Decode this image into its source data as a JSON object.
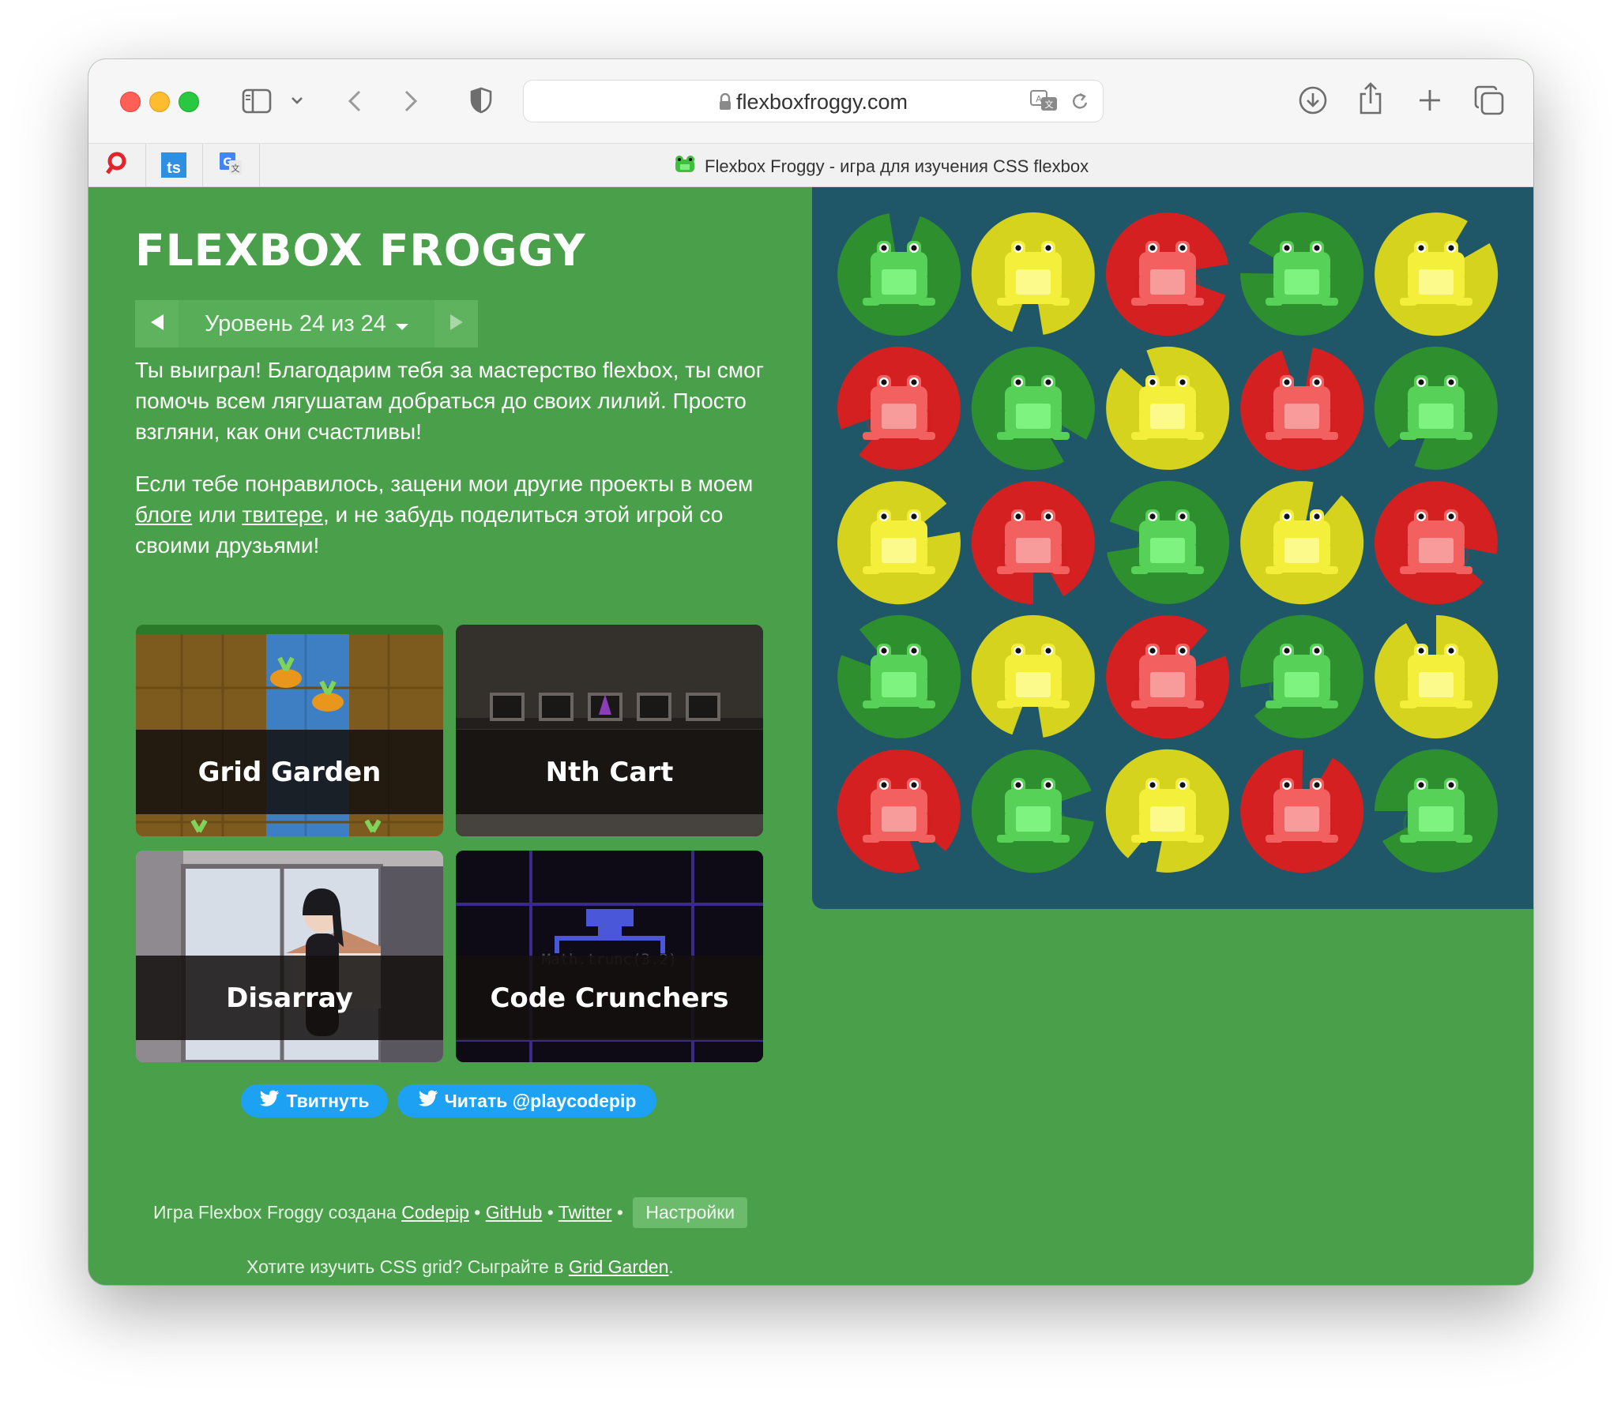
{
  "browser": {
    "url": "flexboxfroggy.com",
    "tab_title": "Flexbox Froggy - игра для изучения CSS flexbox",
    "pinned_tabs": [
      "ts"
    ]
  },
  "game": {
    "title": "FLEXBOX FROGGY",
    "level_label": "Уровень 24 из 24",
    "para1": "Ты выиграл! Благодарим тебя за мастерство flexbox, ты смог помочь всем лягушатам добраться до своих лилий. Просто взгляни, как они счастливы!",
    "para2_a": "Если тебе понравилось, зацени мои другие проекты в моем",
    "para2_link1": "блоге",
    "para2_b": "или",
    "para2_link2": "твитере",
    "para2_c": ", и не забудь поделиться этой игрой со своими друзьями!",
    "cards": [
      {
        "label": "Grid Garden"
      },
      {
        "label": "Nth Cart"
      },
      {
        "label": "Disarray"
      },
      {
        "label": "Code Crunchers",
        "code_hint": "Math.trunc(3.2)"
      }
    ],
    "tweet_button": "Твитнуть",
    "follow_button": "Читать @playcodepip",
    "footer1_text": "Игра Flexbox Froggy создана",
    "footer1_link1": "Codepip",
    "footer1_link2": "GitHub",
    "footer1_link3": "Twitter",
    "footer_separator": "•",
    "settings_button": "Настройки",
    "footer2_text": "Хотите изучить CSS grid? Сыграйте в",
    "footer2_link": "Grid Garden",
    "footer2_end": "."
  },
  "pond": {
    "colors": {
      "green": {
        "pad": "#2e8f2e",
        "frog": "#57d157",
        "belly": "#7ff37f"
      },
      "yellow": {
        "pad": "#d6d31f",
        "frog": "#f3ef3a",
        "belly": "#fbfa8a"
      },
      "red": {
        "pad": "#d42020",
        "frog": "#f26060",
        "belly": "#f79b9b"
      }
    },
    "rows": [
      [
        "green",
        "yellow",
        "red",
        "green",
        "yellow"
      ],
      [
        "red",
        "green",
        "yellow",
        "red",
        "green"
      ],
      [
        "yellow",
        "red",
        "green",
        "yellow",
        "red"
      ],
      [
        "green",
        "yellow",
        "red",
        "green",
        "yellow"
      ],
      [
        "red",
        "green",
        "yellow",
        "red",
        "green"
      ]
    ]
  }
}
